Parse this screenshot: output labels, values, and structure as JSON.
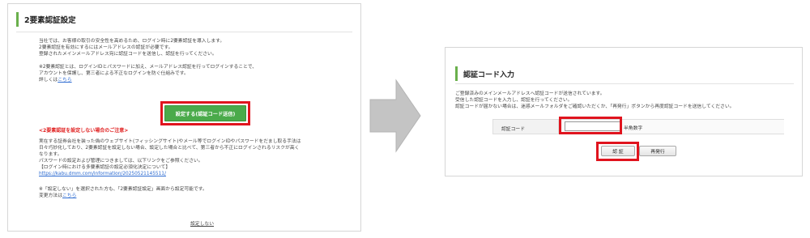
{
  "left": {
    "title": "2要素認証設定",
    "intro": [
      "当社では、お客様の取引の安全性を高めるため、ログイン時に2要素認証を導入します。",
      "2要素認証を有効にするにはメールアドレスの認証が必要です。",
      "登録されたメインメールアドレス宛に認証コードを送信し、認証を行ってください。"
    ],
    "about": [
      "※2要素認証とは、ログインIDとパスワードに加え、メールアドレス認証を行ってログインすることで、",
      "アカウントを保護し、第三者による不正なログインを防ぐ仕組みです。"
    ],
    "details_prefix": "詳しくは",
    "details_link": "こちら",
    "setup_button": "設定する(認証コード送信)",
    "warning_heading": "<2要素認証を設定しない場合のご注意>",
    "warning_lines": [
      "実在する証券会社を装った偽のウェブサイト(フィッシングサイト)やメール等でログインIDやパスワードをだまし取る手法は",
      "日々巧妙化しており、2要素認証を設定しない場合、設定した場合と比べて、第三者から不正にログインされるリスクが高く",
      "なります。",
      "パスワードの設定および管理につきましては、以下リンクをご参照ください。",
      "【ログイン時における多要素認証の設定必須化決定について】"
    ],
    "info_url": "https://kabu.dmm.com/information/20250521145511/",
    "later_note": "※「設定しない」を選択された方も、「2要素認証設定」画面から設定可能です。",
    "method_prefix": "変更方法は",
    "method_link": "こちら",
    "skip_link": "設定しない"
  },
  "right": {
    "title": "認証コード入力",
    "instructions": [
      "ご登録済みのメインメールアドレスへ認証コードが送信されています。",
      "受信した認証コードを入力し、認証を行ってください。",
      "認証コードが届かない場合は、迷惑メールフォルダをご確認いただくか、「再発行」ボタンから再度認証コードを送信してください。"
    ],
    "code_label": "認証コード",
    "code_value": "",
    "code_placeholder": "",
    "code_hint": "半角数字",
    "auth_button": "認 証",
    "resend_button": "再発行"
  },
  "colors": {
    "accent_green": "#6ab04c",
    "button_green": "#4aaa4a",
    "highlight_red": "#e0141e",
    "warning_red": "#e02020",
    "link_blue": "#2d6bd1",
    "arrow_gray": "#c4c4c4"
  },
  "icons": {
    "transition": "right-arrow-icon"
  }
}
